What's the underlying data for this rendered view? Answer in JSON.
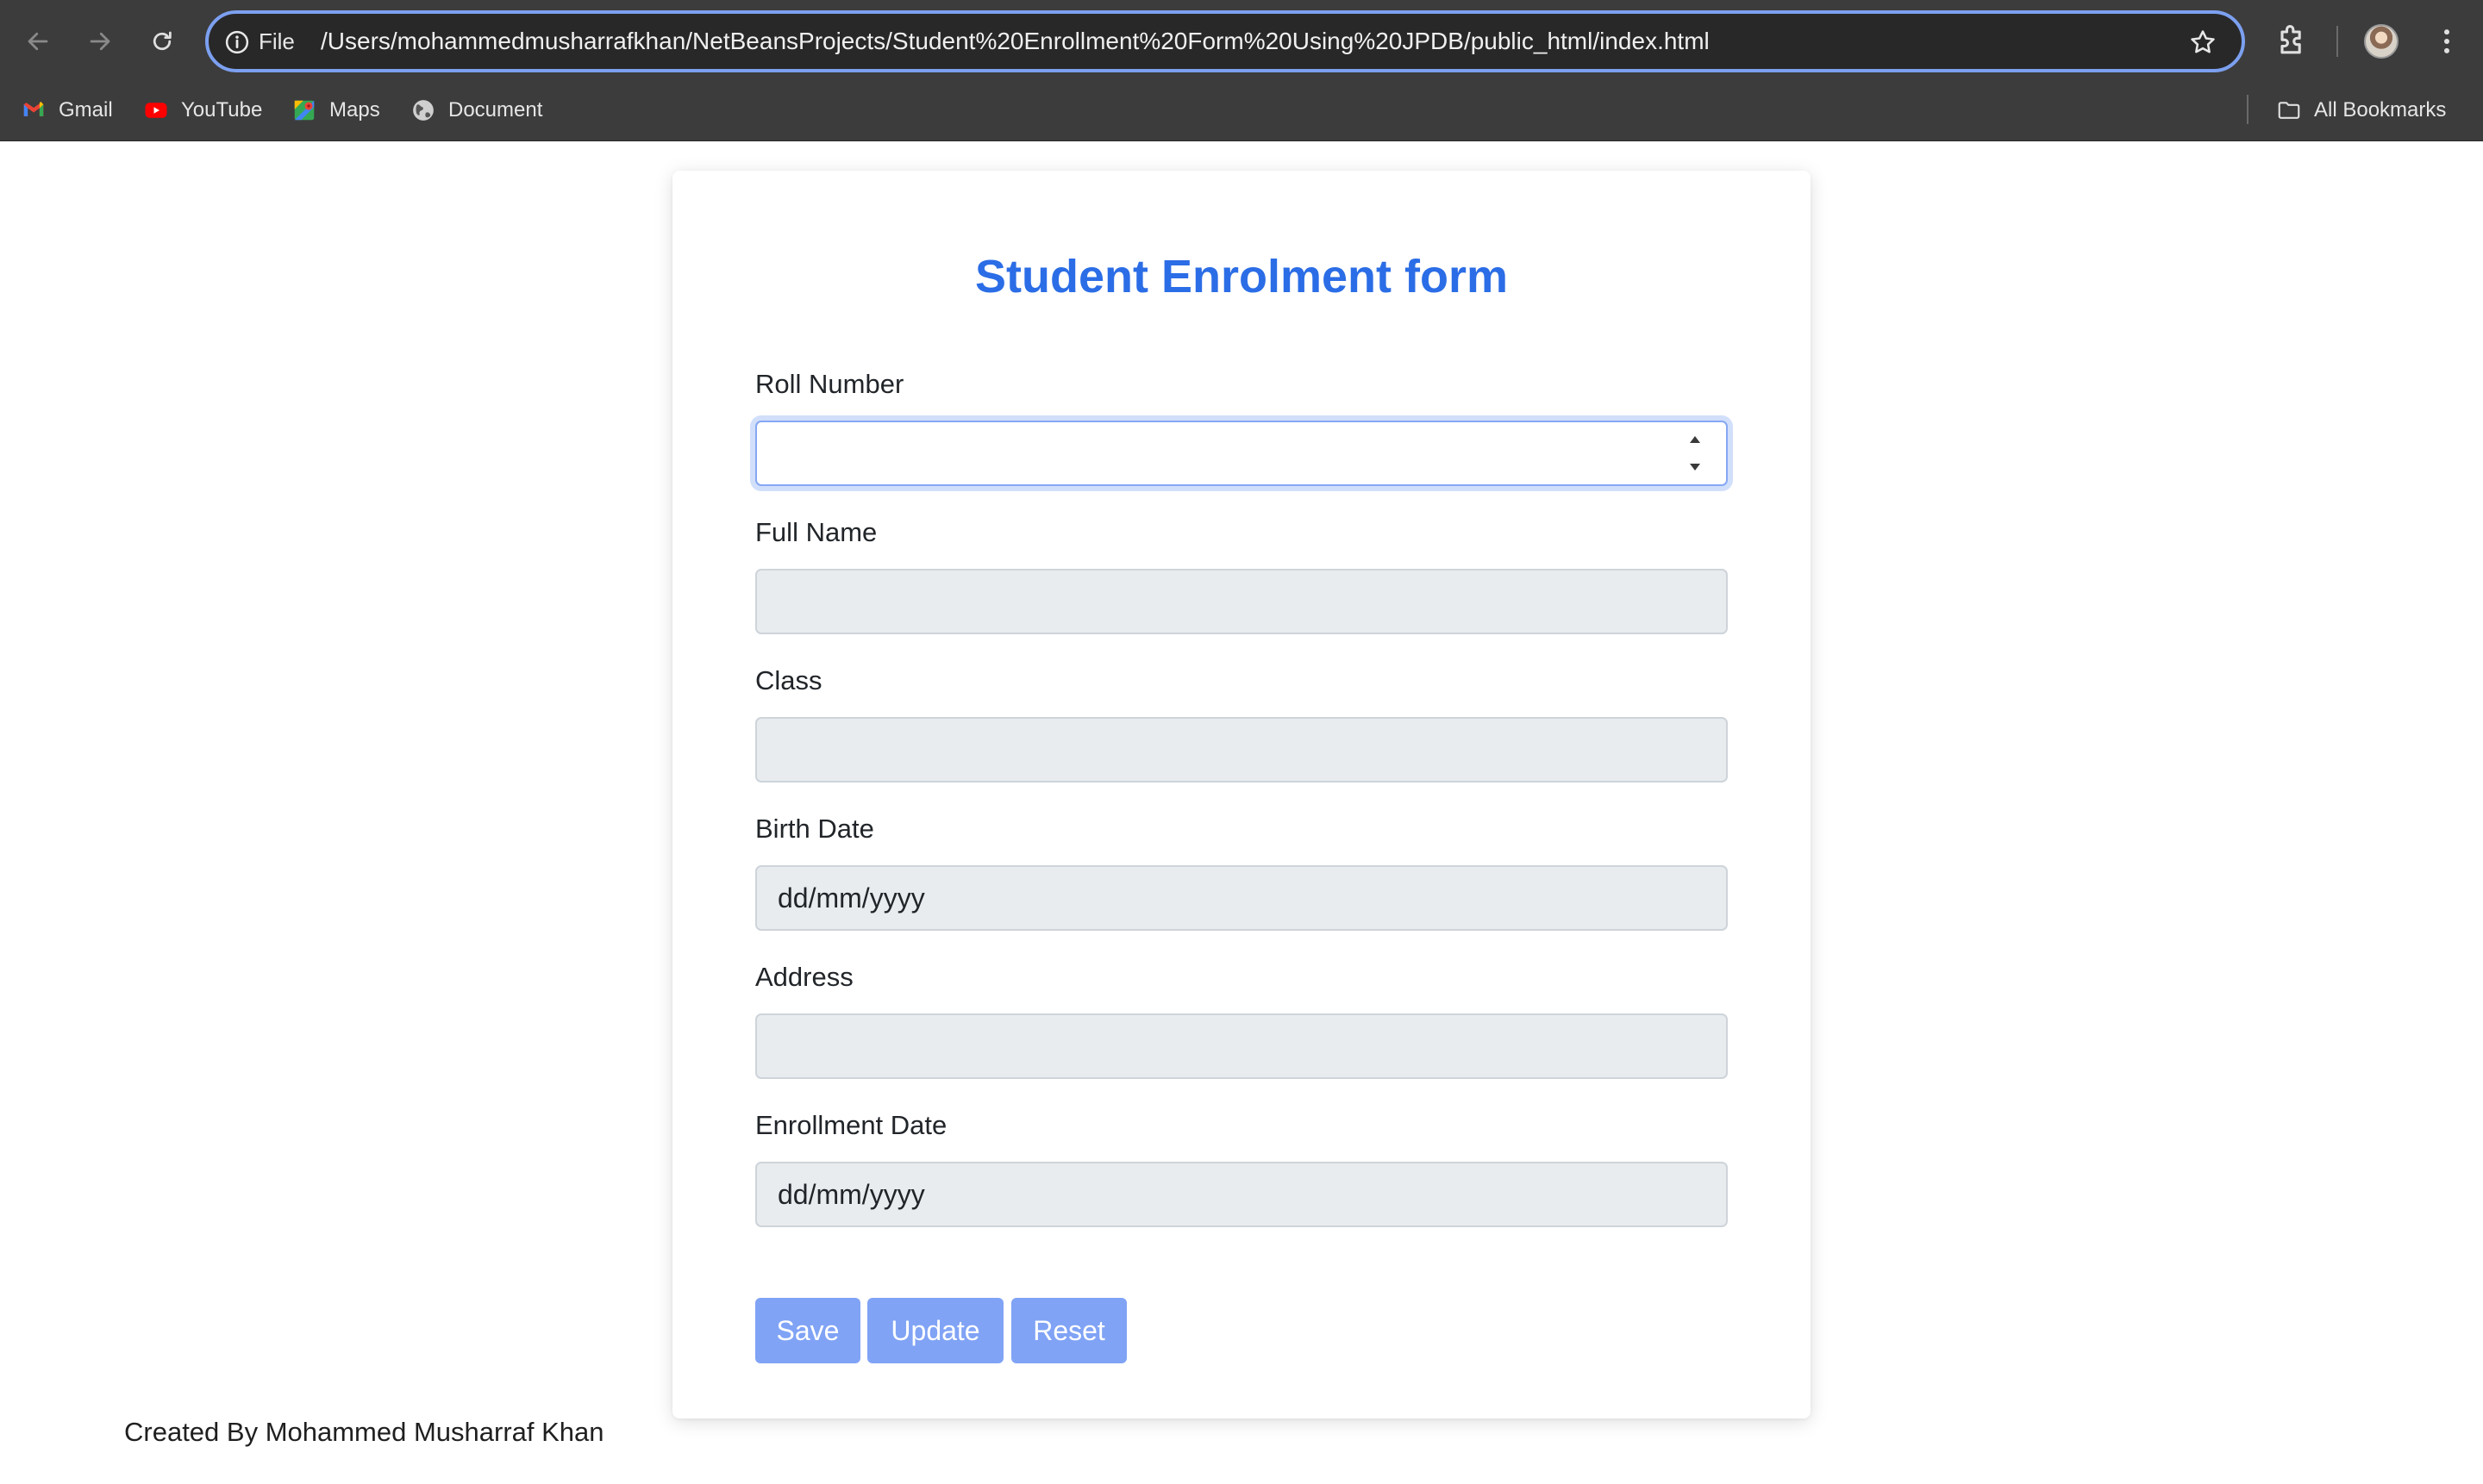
{
  "browser": {
    "omnibox": {
      "chip_label": "File",
      "url": "/Users/mohammedmusharrafkhan/NetBeansProjects/Student%20Enrollment%20Form%20Using%20JPDB/public_html/index.html"
    },
    "bookmarks": [
      {
        "label": "Gmail",
        "icon": "gmail-icon"
      },
      {
        "label": "YouTube",
        "icon": "youtube-icon"
      },
      {
        "label": "Maps",
        "icon": "maps-icon"
      },
      {
        "label": "Document",
        "icon": "globe-icon"
      }
    ],
    "all_bookmarks_label": "All Bookmarks"
  },
  "form": {
    "title": "Student Enrolment form",
    "fields": [
      {
        "label": "Roll Number",
        "value": "",
        "state": "focused"
      },
      {
        "label": "Full Name",
        "value": ""
      },
      {
        "label": "Class",
        "value": ""
      },
      {
        "label": "Birth Date",
        "value": "dd/mm/yyyy"
      },
      {
        "label": "Address",
        "value": ""
      },
      {
        "label": "Enrollment Date",
        "value": "dd/mm/yyyy"
      }
    ],
    "buttons": {
      "save": "Save",
      "update": "Update",
      "reset": "Reset"
    }
  },
  "footer": {
    "credit": "Created By Mohammed Musharraf Khan"
  },
  "colors": {
    "accent": "#2b6de6",
    "button": "#80a3f5",
    "disabled_field": "#e9ecef",
    "chrome": "#3c3c3c"
  }
}
